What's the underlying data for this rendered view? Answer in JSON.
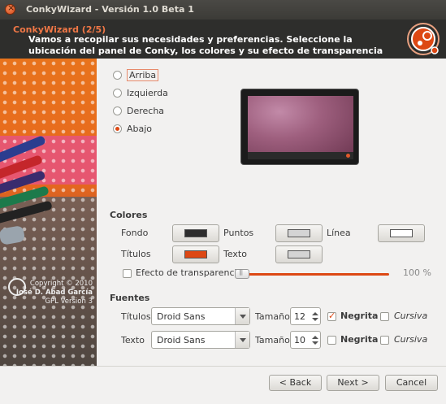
{
  "window": {
    "title": "ConkyWizard - Versión 1.0 Beta 1"
  },
  "header": {
    "step": "ConkyWizard (2/5)",
    "description": "Vamos a recopilar sus necesidades y preferencias. Seleccione la ubicación del panel de Conky, los colores y su efecto de transparencia"
  },
  "sidebar": {
    "copyright": "Copyright © 2010",
    "author": "José D. Abad García",
    "license": "GPL Version 3"
  },
  "position": {
    "options": [
      {
        "label": "Arriba",
        "selected": false
      },
      {
        "label": "Izquierda",
        "selected": false
      },
      {
        "label": "Derecha",
        "selected": false
      },
      {
        "label": "Abajo",
        "selected": true
      }
    ]
  },
  "colors": {
    "heading": "Colores",
    "fondo": {
      "label": "Fondo",
      "color": "#2d2d2d"
    },
    "puntos": {
      "label": "Puntos",
      "color": "#d4d4d4"
    },
    "linea": {
      "label": "Línea",
      "color": "#ffffff"
    },
    "titulos": {
      "label": "Títulos",
      "color": "#dd4814"
    },
    "texto": {
      "label": "Texto",
      "color": "#d4d4d4"
    },
    "transparency": {
      "label": "Efecto de transparencia",
      "checked": false,
      "value_label": "100 %",
      "level": 0.0
    }
  },
  "fonts": {
    "heading": "Fuentes",
    "titulos": {
      "label": "Títulos",
      "font": "Droid Sans",
      "size_label": "Tamaño",
      "size": "12",
      "bold_label": "Negrita",
      "bold": true,
      "italic_label": "Cursiva",
      "italic": false
    },
    "texto": {
      "label": "Texto",
      "font": "Droid Sans",
      "size_label": "Tamaño",
      "size": "10",
      "bold_label": "Negrita",
      "bold": false,
      "italic_label": "Cursiva",
      "italic": false
    }
  },
  "footer": {
    "back": "< Back",
    "next": "Next >",
    "cancel": "Cancel"
  },
  "accent": "#dd4814"
}
